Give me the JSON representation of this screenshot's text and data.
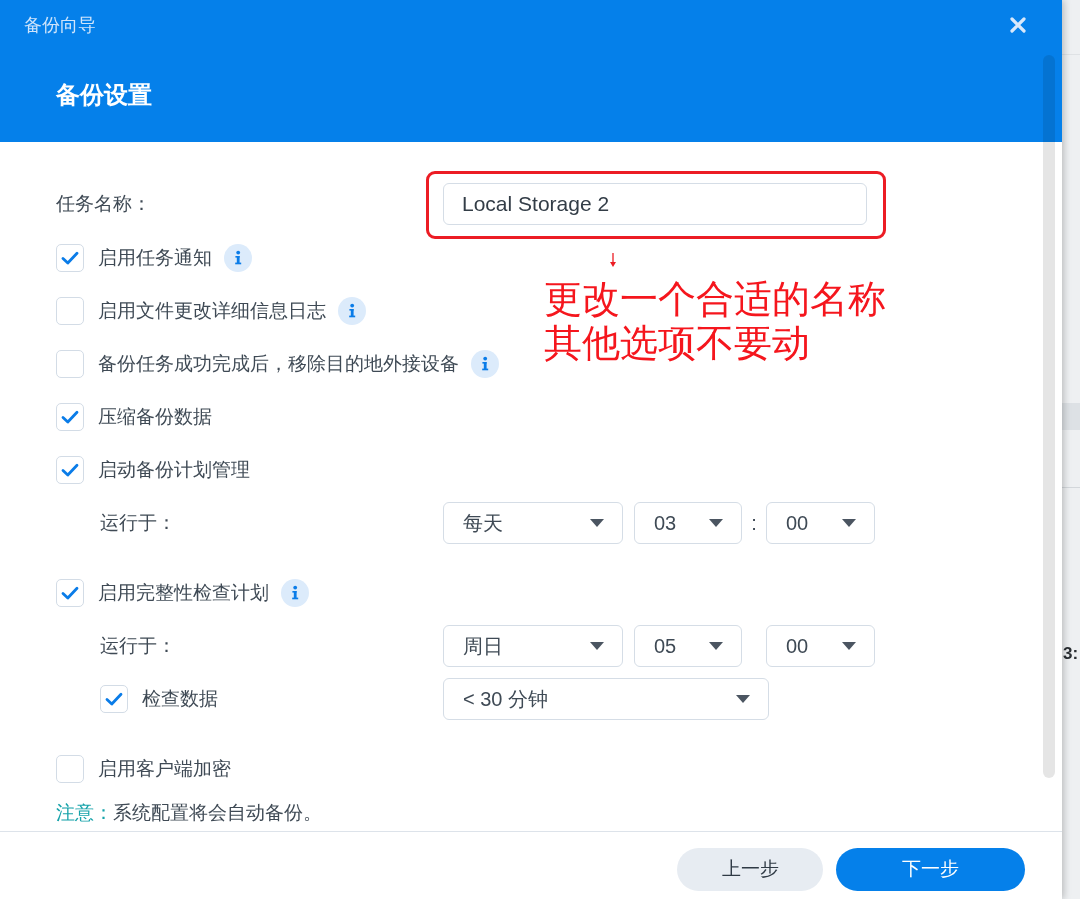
{
  "window": {
    "title": "备份向导"
  },
  "header": {
    "title": "备份设置"
  },
  "form": [
    {
      "kind": "text",
      "label": "任务名称：",
      "value": "Local Storage 2"
    },
    {
      "kind": "checkbox",
      "label": "启用任务通知",
      "checked": true,
      "info": true
    },
    {
      "kind": "checkbox",
      "label": "启用文件更改详细信息日志",
      "checked": false,
      "info": true
    },
    {
      "kind": "checkbox",
      "label": "备份任务成功完成后，移除目的地外接设备",
      "checked": false,
      "info": true
    },
    {
      "kind": "checkbox",
      "label": "压缩备份数据",
      "checked": true,
      "info": false
    },
    {
      "kind": "checkbox",
      "label": "启动备份计划管理",
      "checked": true,
      "info": false,
      "children": [
        {
          "kind": "schedule",
          "label": "运行于：",
          "selects": [
            "每天",
            "03",
            "00"
          ],
          "separator": ":"
        }
      ]
    },
    {
      "kind": "checkbox",
      "label": "启用完整性检查计划",
      "checked": true,
      "info": true,
      "children": [
        {
          "kind": "schedule",
          "label": "运行于：",
          "selects": [
            "周日",
            "05",
            "00"
          ]
        },
        {
          "kind": "checkbox",
          "label": "检查数据",
          "checked": true,
          "info": false,
          "selects": [
            "< 30 分钟"
          ]
        }
      ]
    },
    {
      "kind": "checkbox",
      "label": "启用客户端加密",
      "checked": false,
      "info": false
    },
    {
      "kind": "note",
      "label": "注意：",
      "text": "系统配置将会自动备份。"
    }
  ],
  "footer": {
    "buttons": [
      {
        "label": "上一步",
        "primary": false
      },
      {
        "label": "下一步",
        "primary": true
      }
    ]
  },
  "annotation": {
    "lines": [
      "更改一个合适的名称",
      "其他选项不要动"
    ]
  },
  "background": {
    "fragment": "3:"
  }
}
